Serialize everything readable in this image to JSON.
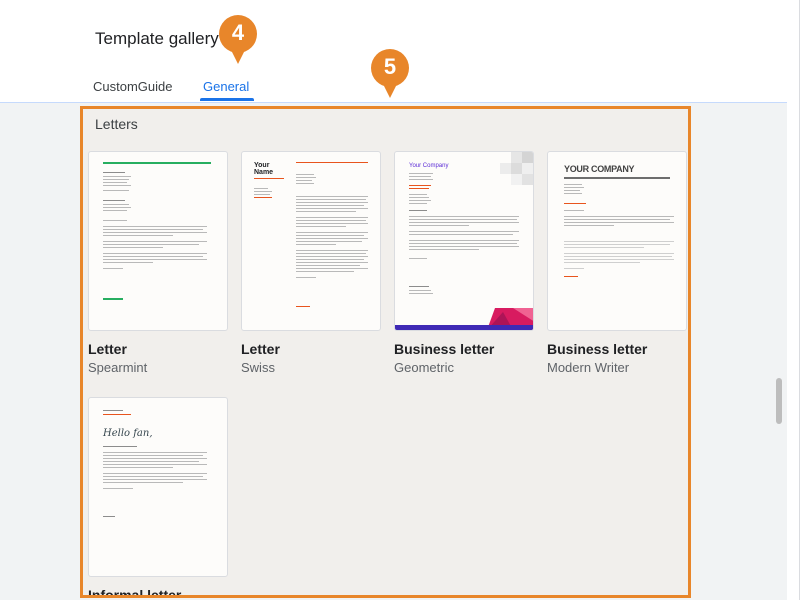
{
  "header": {
    "title": "Template gallery"
  },
  "callouts": {
    "first": "4",
    "second": "5"
  },
  "tabs": [
    {
      "label": "CustomGuide"
    },
    {
      "label": "General"
    }
  ],
  "section": {
    "label": "Letters"
  },
  "templates": [
    {
      "name": "Letter",
      "subtitle": "Spearmint"
    },
    {
      "name": "Letter",
      "subtitle": "Swiss"
    },
    {
      "name": "Business letter",
      "subtitle": "Geometric"
    },
    {
      "name": "Business letter",
      "subtitle": "Modern Writer"
    },
    {
      "name": "Informal letter",
      "subtitle": ""
    }
  ],
  "thumb_text": {
    "swiss_name": "Your Name",
    "geometric_company": "Your Company",
    "modern_company": "YOUR COMPANY",
    "informal_heading": "Hello fan,"
  },
  "colors": {
    "accent_orange": "#e8862a",
    "tab_blue": "#1a73e8",
    "spearmint_green": "#27ae60",
    "swiss_red": "#e8541d",
    "geometric_purple": "#5b2bd6",
    "geometric_pink": "#d81b60"
  }
}
